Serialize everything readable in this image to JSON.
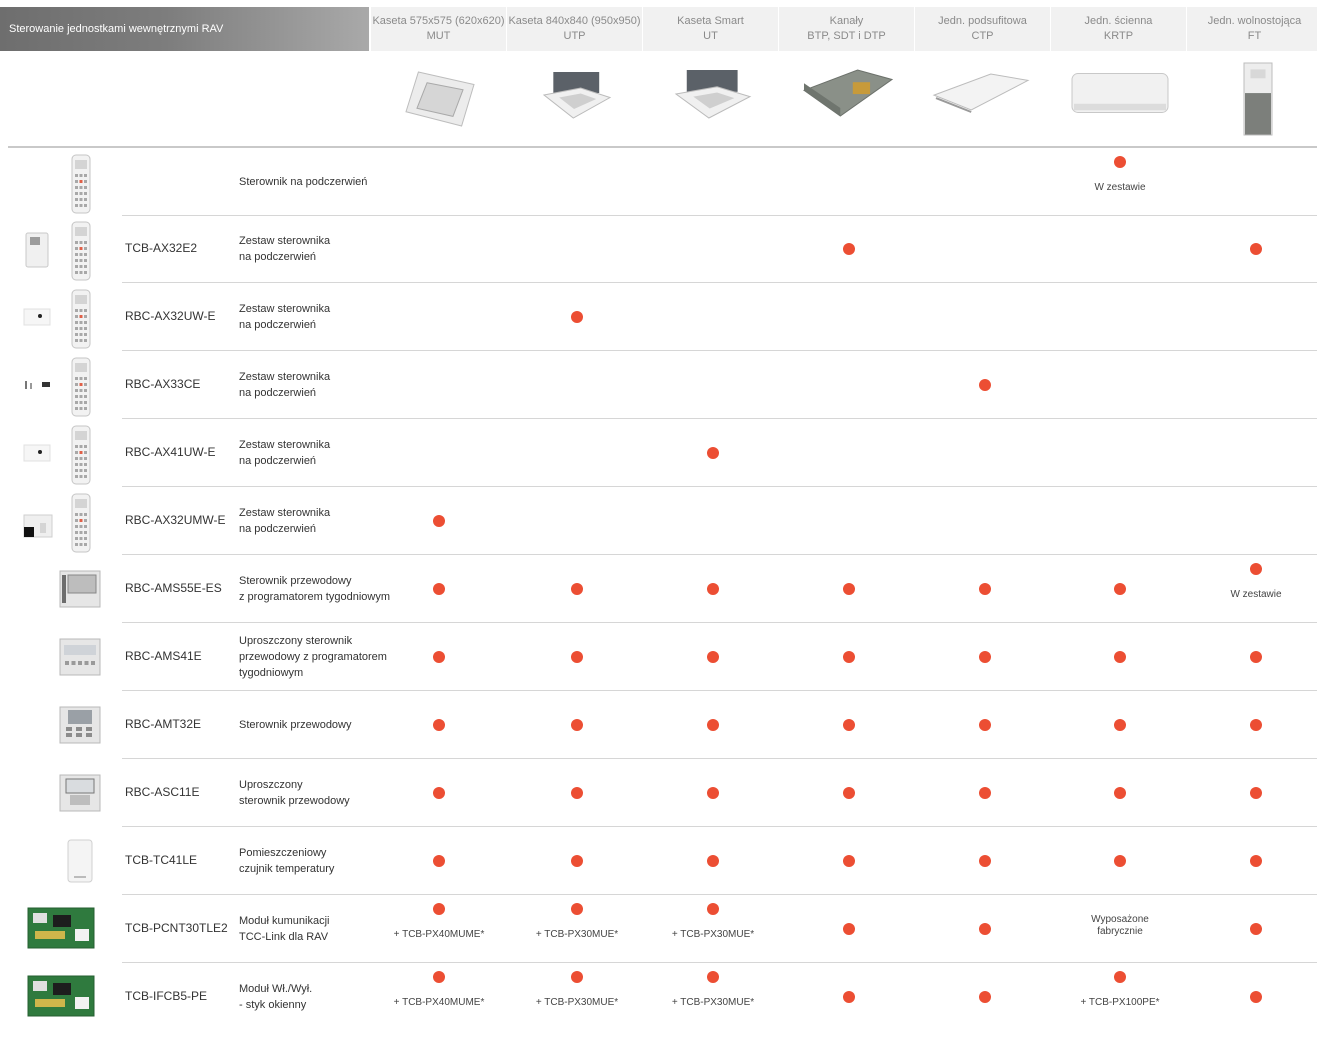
{
  "header": {
    "title": "Sterowanie jednostkami wewnętrznymi RAV",
    "columns": [
      {
        "line1": "Kaseta 575x575 (620x620)",
        "line2": "MUT"
      },
      {
        "line1": "Kaseta 840x840 (950x950)",
        "line2": "UTP"
      },
      {
        "line1": "Kaseta Smart",
        "line2": "UT"
      },
      {
        "line1": "Kanały",
        "line2": "BTP, SDT i DTP"
      },
      {
        "line1": "Jedn. podsufitowa",
        "line2": "CTP"
      },
      {
        "line1": "Jedn. ścienna",
        "line2": "KRTP"
      },
      {
        "line1": "Jedn. wolnostojąca",
        "line2": "FT"
      }
    ]
  },
  "rows": [
    {
      "code": "",
      "desc": [
        "Sterownik na podczerwień"
      ],
      "cells": [
        "",
        "",
        "",
        "",
        "",
        {
          "dot": true,
          "note": "W zestawie"
        },
        ""
      ]
    },
    {
      "code": "TCB-AX32E2",
      "desc": [
        "Zestaw sterownika",
        "na podczerwień"
      ],
      "cells": [
        "",
        "",
        "",
        {
          "dot": true
        },
        "",
        "",
        {
          "dot": true
        }
      ]
    },
    {
      "code": "RBC-AX32UW-E",
      "desc": [
        "Zestaw sterownika",
        "na podczerwień"
      ],
      "cells": [
        "",
        {
          "dot": true
        },
        "",
        "",
        "",
        "",
        ""
      ]
    },
    {
      "code": "RBC-AX33CE",
      "desc": [
        "Zestaw sterownika",
        "na podczerwień"
      ],
      "cells": [
        "",
        "",
        "",
        "",
        {
          "dot": true
        },
        "",
        ""
      ]
    },
    {
      "code": "RBC-AX41UW-E",
      "desc": [
        "Zestaw sterownika",
        "na podczerwień"
      ],
      "cells": [
        "",
        "",
        {
          "dot": true
        },
        "",
        "",
        "",
        ""
      ]
    },
    {
      "code": "RBC-AX32UMW-E",
      "desc": [
        "Zestaw sterownika",
        "na podczerwień"
      ],
      "cells": [
        {
          "dot": true
        },
        "",
        "",
        "",
        "",
        "",
        ""
      ]
    },
    {
      "code": "RBC-AMS55E-ES",
      "desc": [
        "Sterownik przewodowy",
        "z programatorem tygodniowym"
      ],
      "cells": [
        {
          "dot": true
        },
        {
          "dot": true
        },
        {
          "dot": true
        },
        {
          "dot": true
        },
        {
          "dot": true
        },
        {
          "dot": true
        },
        {
          "dot": true,
          "note": "W zestawie"
        }
      ]
    },
    {
      "code": "RBC-AMS41E",
      "desc": [
        "Uproszczony sterownik",
        "przewodowy z programatorem",
        "tygodniowym"
      ],
      "cells": [
        {
          "dot": true
        },
        {
          "dot": true
        },
        {
          "dot": true
        },
        {
          "dot": true
        },
        {
          "dot": true
        },
        {
          "dot": true
        },
        {
          "dot": true
        }
      ]
    },
    {
      "code": "RBC-AMT32E",
      "desc": [
        "Sterownik przewodowy"
      ],
      "cells": [
        {
          "dot": true
        },
        {
          "dot": true
        },
        {
          "dot": true
        },
        {
          "dot": true
        },
        {
          "dot": true
        },
        {
          "dot": true
        },
        {
          "dot": true
        }
      ]
    },
    {
      "code": "RBC-ASC11E",
      "desc": [
        "Uproszczony",
        "sterownik przewodowy"
      ],
      "cells": [
        {
          "dot": true
        },
        {
          "dot": true
        },
        {
          "dot": true
        },
        {
          "dot": true
        },
        {
          "dot": true
        },
        {
          "dot": true
        },
        {
          "dot": true
        }
      ]
    },
    {
      "code": "TCB-TC41LE",
      "desc": [
        "Pomieszczeniowy",
        "czujnik temperatury"
      ],
      "cells": [
        {
          "dot": true
        },
        {
          "dot": true
        },
        {
          "dot": true
        },
        {
          "dot": true
        },
        {
          "dot": true
        },
        {
          "dot": true
        },
        {
          "dot": true
        }
      ]
    },
    {
      "code": "TCB-PCNT30TLE2",
      "desc": [
        "Moduł kumunikacji",
        "TCC-Link dla RAV"
      ],
      "cells": [
        {
          "dot": true,
          "note": "+ TCB-PX40MUME*"
        },
        {
          "dot": true,
          "note": "+ TCB-PX30MUE*"
        },
        {
          "dot": true,
          "note": "+ TCB-PX30MUE*"
        },
        {
          "dot": true
        },
        {
          "dot": true
        },
        {
          "text": [
            "Wyposażone",
            "fabrycznie"
          ]
        },
        {
          "dot": true
        }
      ]
    },
    {
      "code": "TCB-IFCB5-PE",
      "desc": [
        "Moduł Wł./Wył.",
        "- styk okienny"
      ],
      "cells": [
        {
          "dot": true,
          "note": "+ TCB-PX40MUME*"
        },
        {
          "dot": true,
          "note": "+ TCB-PX30MUE*"
        },
        {
          "dot": true,
          "note": "+ TCB-PX30MUE*"
        },
        {
          "dot": true
        },
        {
          "dot": true
        },
        {
          "dot": true,
          "note": "+ TCB-PX100PE*"
        },
        {
          "dot": true
        }
      ]
    }
  ],
  "icons": {
    "products": [
      "cassette-575-image",
      "cassette-840-image",
      "cassette-smart-image",
      "duct-unit-image",
      "ceiling-unit-image",
      "wall-unit-image",
      "floor-standing-unit-image"
    ],
    "rows": [
      "ir-remote-icon",
      "ir-receiver-set-icon",
      "ir-receiver-set-icon",
      "ir-receiver-set-icon",
      "ir-receiver-set-icon",
      "ir-receiver-set-icon",
      "wired-controller-icon",
      "wired-controller-icon",
      "wired-controller-icon",
      "wired-controller-icon",
      "temperature-sensor-icon",
      "pcb-module-icon",
      "pcb-module-icon"
    ]
  },
  "colors": {
    "dot": "#ec4e33",
    "header_bg": "#f1f1f1",
    "title_bg": "#7a7a7a"
  }
}
